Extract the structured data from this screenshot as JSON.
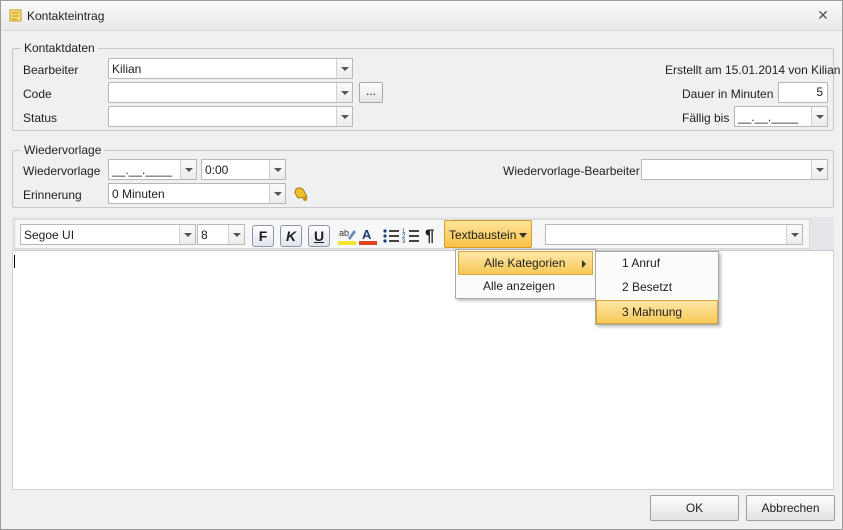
{
  "window": {
    "title": "Kontakteintrag",
    "close_glyph": "✕"
  },
  "kontaktdaten": {
    "legend": "Kontaktdaten",
    "bearbeiter_label": "Bearbeiter",
    "bearbeiter_value": "Kilian",
    "code_label": "Code",
    "code_value": "",
    "code_browse": "...",
    "status_label": "Status",
    "status_value": "",
    "created_text": "Erstellt am 15.01.2014 von Kilian",
    "dauer_label": "Dauer in Minuten",
    "dauer_value": "5",
    "faellig_label": "Fällig bis",
    "faellig_value": "__.__.____"
  },
  "wiedervorlage": {
    "legend": "Wiedervorlage",
    "date_label": "Wiedervorlage",
    "date_value": "__.__.____",
    "time_value": "0:00",
    "bearbeiter_label": "Wiedervorlage-Bearbeiter",
    "bearbeiter_value": "",
    "erinnerung_label": "Erinnerung",
    "erinnerung_value": "0 Minuten"
  },
  "toolbar": {
    "font_name": "Segoe UI",
    "font_size": "8",
    "bold": "F",
    "italic": "K",
    "underline": "U",
    "paragraph": "¶",
    "textbaustein": "Textbaustein",
    "textbaustein_value": ""
  },
  "menu": {
    "items": [
      "Alle Kategorien",
      "Alle anzeigen"
    ],
    "submenu": [
      "1  Anruf",
      "2  Besetzt",
      "3  Mahnung"
    ]
  },
  "footer": {
    "ok": "OK",
    "cancel": "Abbrechen"
  },
  "colors": {
    "accent": "#f7c957",
    "accent_border": "#d79b1f"
  }
}
